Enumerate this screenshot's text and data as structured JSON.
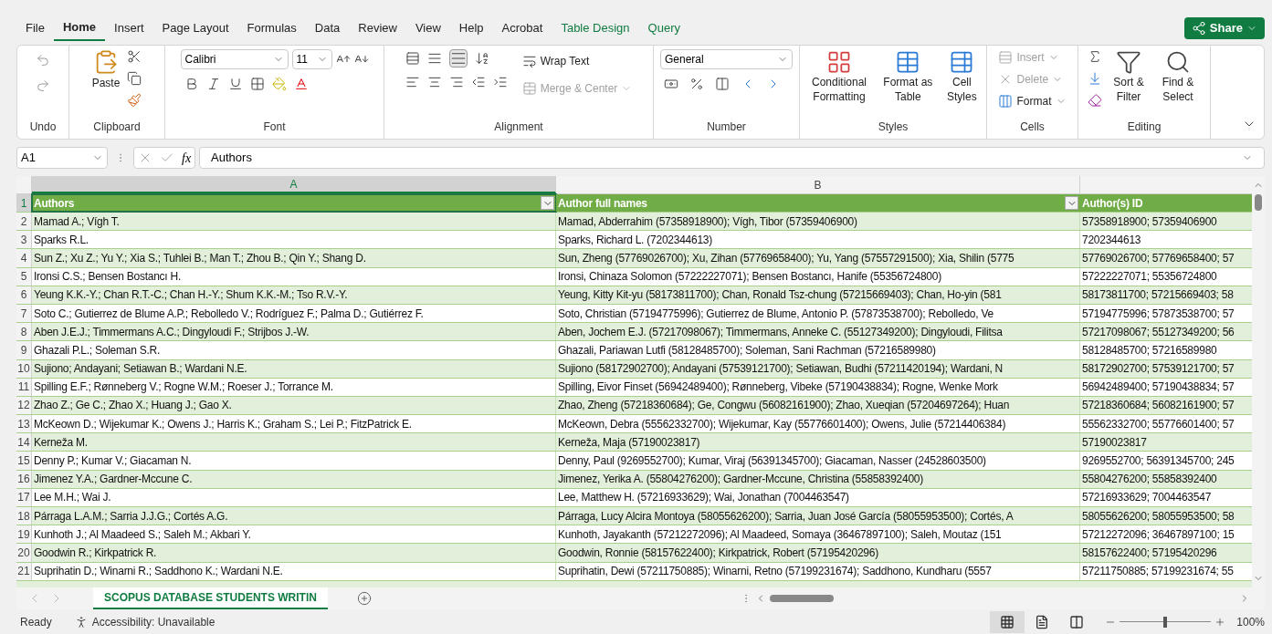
{
  "tabs": [
    {
      "label": "File",
      "selected": false,
      "kind": "normal"
    },
    {
      "label": "Home",
      "selected": true,
      "kind": "normal"
    },
    {
      "label": "Insert",
      "selected": false,
      "kind": "normal"
    },
    {
      "label": "Page Layout",
      "selected": false,
      "kind": "normal"
    },
    {
      "label": "Formulas",
      "selected": false,
      "kind": "normal"
    },
    {
      "label": "Data",
      "selected": false,
      "kind": "normal"
    },
    {
      "label": "Review",
      "selected": false,
      "kind": "normal"
    },
    {
      "label": "View",
      "selected": false,
      "kind": "normal"
    },
    {
      "label": "Help",
      "selected": false,
      "kind": "normal"
    },
    {
      "label": "Acrobat",
      "selected": false,
      "kind": "normal"
    },
    {
      "label": "Table Design",
      "selected": false,
      "kind": "contextual"
    },
    {
      "label": "Query",
      "selected": false,
      "kind": "contextual"
    }
  ],
  "share": "Share",
  "ribbon": {
    "groups": [
      "Undo",
      "Clipboard",
      "Font",
      "Alignment",
      "Number",
      "Styles",
      "Cells",
      "Editing"
    ],
    "paste": "Paste",
    "font": "Calibri",
    "size": "11",
    "wrap_text": "Wrap Text",
    "merge_center": {
      "label": "Merge & Center",
      "disabled": true
    },
    "number_format": "General",
    "conditional_formatting": "Conditional Formatting",
    "format_as_table": "Format as Table",
    "cell_styles": "Cell Styles",
    "insert": {
      "label": "Insert",
      "disabled": true
    },
    "delete": {
      "label": "Delete",
      "disabled": true
    },
    "format": {
      "label": "Format",
      "disabled": false
    },
    "sort_filter": "Sort & Filter",
    "find_select": "Find & Select"
  },
  "formula_bar": {
    "name_box": "A1",
    "fx": "fx",
    "value": "Authors"
  },
  "sheet": {
    "columns": [
      {
        "label": "A",
        "selected": true
      },
      {
        "label": "B",
        "selected": false
      }
    ],
    "header_row": {
      "number": "1",
      "selected": true,
      "cells": [
        {
          "text": "Authors",
          "filter": true
        },
        {
          "text": "Author full names",
          "filter": true
        },
        {
          "text": "Author(s) ID",
          "filter": false
        }
      ]
    },
    "rows": [
      {
        "number": "2",
        "cells": [
          "Mamad A.; Vígh T.",
          "Mamad, Abderrahim (57358918900); Vígh, Tibor (57359406900)",
          "57358918900; 57359406900"
        ]
      },
      {
        "number": "3",
        "cells": [
          "Sparks R.L.",
          "Sparks, Richard L. (7202344613)",
          "7202344613"
        ]
      },
      {
        "number": "4",
        "cells": [
          "Sun Z.; Xu Z.; Yu Y.; Xia S.; Tuhlei B.; Man T.; Zhou B.; Qin Y.; Shang D.",
          "Sun, Zheng (57769026700); Xu, Zihan (57769658400); Yu, Yang (57557291500); Xia, Shilin (5775",
          "57769026700; 57769658400; 57"
        ]
      },
      {
        "number": "5",
        "cells": [
          "Ironsi C.S.; Bensen Bostancı H.",
          "Ironsi, Chinaza Solomon (57222227071); Bensen Bostancı, Hanife (55356724800)",
          "57222227071; 55356724800"
        ]
      },
      {
        "number": "6",
        "cells": [
          "Yeung K.K.-Y.; Chan R.T.-C.; Chan H.-Y.; Shum K.K.-M.; Tso R.V.-Y.",
          "Yeung, Kitty Kit-yu (58173811700); Chan, Ronald Tsz-chung (57215669403); Chan, Ho-yin (581",
          "58173811700; 57215669403; 58"
        ]
      },
      {
        "number": "7",
        "cells": [
          "Soto C.; Gutierrez de Blume A.P.; Rebolledo V.; Rodríguez F.; Palma D.; Gutiérrez F.",
          "Soto, Christian (57194775996); Gutierrez de Blume, Antonio P. (57873538700); Rebolledo, Ve",
          "57194775996; 57873538700; 57"
        ]
      },
      {
        "number": "8",
        "cells": [
          "Aben J.E.J.; Timmermans A.C.; Dingyloudi F.; Strijbos J.-W.",
          "Aben, Jochem E.J. (57217098067); Timmermans, Anneke C. (55127349200); Dingyloudi, Filitsa",
          "57217098067; 55127349200; 56"
        ]
      },
      {
        "number": "9",
        "cells": [
          "Ghazali P.L.; Soleman S.R.",
          "Ghazali, Pariawan Lutfi (58128485700); Soleman, Sani Rachman (57216589980)",
          "58128485700; 57216589980"
        ]
      },
      {
        "number": "10",
        "cells": [
          "Sujiono; Andayani; Setiawan B.; Wardani N.E.",
          "Sujiono (58172902700); Andayani (57539121700); Setiawan, Budhi (57211420194); Wardani, N",
          "58172902700; 57539121700; 57"
        ]
      },
      {
        "number": "11",
        "cells": [
          "Spilling E.F.; Rønneberg V.; Rogne W.M.; Roeser J.; Torrance M.",
          "Spilling, Eivor Finset (56942489400); Rønneberg, Vibeke (57190438834); Rogne, Wenke Mork",
          "56942489400; 57190438834; 57"
        ]
      },
      {
        "number": "12",
        "cells": [
          "Zhao Z.; Ge C.; Zhao X.; Huang J.; Gao X.",
          "Zhao, Zheng (57218360684); Ge, Congwu (56082161900); Zhao, Xueqian (57204697264); Huan",
          "57218360684; 56082161900; 57"
        ]
      },
      {
        "number": "13",
        "cells": [
          "McKeown D.; Wijekumar K.; Owens J.; Harris K.; Graham S.; Lei P.; FitzPatrick E.",
          "McKeown, Debra (55562332700); Wijekumar, Kay (55776601400); Owens, Julie (57214406384)",
          "55562332700; 55776601400; 57"
        ]
      },
      {
        "number": "14",
        "cells": [
          "Kerneža M.",
          "Kerneža, Maja (57190023817)",
          "57190023817"
        ]
      },
      {
        "number": "15",
        "cells": [
          "Denny P.; Kumar V.; Giacaman N.",
          "Denny, Paul (9269552700); Kumar, Viraj (56391345700); Giacaman, Nasser (24528603500)",
          "9269552700; 56391345700; 245"
        ]
      },
      {
        "number": "16",
        "cells": [
          "Jimenez Y.A.; Gardner-Mccune C.",
          "Jimenez, Yerika A. (55804276200); Gardner-Mccune, Christina (55858392400)",
          "55804276200; 55858392400"
        ]
      },
      {
        "number": "17",
        "cells": [
          "Lee M.H.; Wai J.",
          "Lee, Matthew H. (57216933629); Wai, Jonathan (7004463547)",
          "57216933629; 7004463547"
        ]
      },
      {
        "number": "18",
        "cells": [
          "Párraga L.A.M.; Sarria J.J.G.; Cortés A.G.",
          "Párraga, Lucy Alcira Montoya (58055626200); Sarria, Juan José García (58055953500); Cortés, A",
          "58055626200; 58055953500; 58"
        ]
      },
      {
        "number": "19",
        "cells": [
          "Kunhoth J.; Al Maadeed S.; Saleh M.; Akbari Y.",
          "Kunhoth, Jayakanth (57212272096); Al Maadeed, Somaya (36467897100); Saleh, Moutaz (151",
          "57212272096; 36467897100; 15"
        ]
      },
      {
        "number": "20",
        "cells": [
          "Goodwin R.; Kirkpatrick R.",
          "Goodwin, Ronnie (58157622400); Kirkpatrick, Robert (57195420296)",
          "58157622400; 57195420296"
        ]
      },
      {
        "number": "21",
        "cells": [
          "Suprihatin D.; Winarni R.; Saddhono K.; Wardani N.E.",
          "Suprihatin, Dewi (57211750885); Winarni, Retno (57199231674); Saddhono, Kundharu (5557",
          "57211750885; 57199231674; 55"
        ]
      }
    ]
  },
  "sheet_tabs": [
    {
      "label": "SCOPUS DATABASE STUDENTS WRITIN",
      "selected": true
    }
  ],
  "status_bar": {
    "ready": "Ready",
    "accessibility": "Accessibility: Unavailable",
    "views": [
      {
        "selected": true
      },
      {
        "selected": false
      },
      {
        "selected": false
      }
    ],
    "zoom": {
      "level": 0.5,
      "reading": "100%"
    }
  }
}
